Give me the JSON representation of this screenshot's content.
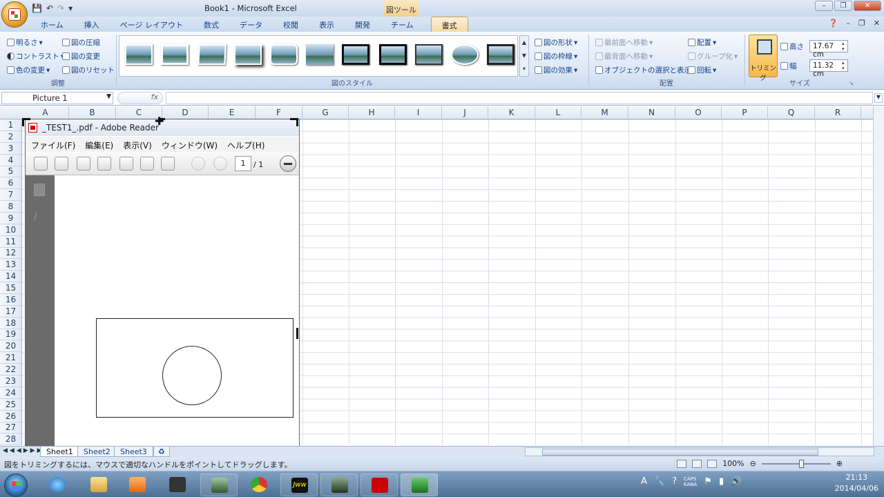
{
  "window": {
    "title": "Book1 - Microsoft Excel",
    "context_tool": "図ツール"
  },
  "tabs": [
    "ホーム",
    "挿入",
    "ページ レイアウト",
    "数式",
    "データ",
    "校閲",
    "表示",
    "開発",
    "チーム",
    "書式"
  ],
  "active_tab": "書式",
  "ribbon": {
    "adjust": {
      "brightness": "明るさ",
      "contrast": "コントラスト",
      "recolor": "色の変更",
      "compress": "図の圧縮",
      "change": "図の変更",
      "reset": "図のリセット",
      "label": "調整"
    },
    "styles": {
      "label": "図のスタイル",
      "shape": "図の形状",
      "border": "図の枠線",
      "effects": "図の効果"
    },
    "arrange": {
      "bring_front": "最前面へ移動",
      "send_back": "最背面へ移動",
      "selection": "オブジェクトの選択と表示",
      "align": "配置",
      "group": "グループ化",
      "rotate": "回転",
      "label": "配置"
    },
    "size": {
      "crop": "トリミング",
      "height_label": "高さ",
      "height": "17.67 cm",
      "width_label": "幅",
      "width": "11.32 cm",
      "label": "サイズ"
    }
  },
  "formula_bar": {
    "name_box": "Picture 1",
    "fx": "fx",
    "value": ""
  },
  "columns": [
    "A",
    "B",
    "C",
    "D",
    "E",
    "F",
    "G",
    "H",
    "I",
    "J",
    "K",
    "L",
    "M",
    "N",
    "O",
    "P",
    "Q",
    "R"
  ],
  "rows": [
    "1",
    "2",
    "3",
    "4",
    "5",
    "6",
    "7",
    "8",
    "9",
    "10",
    "11",
    "12",
    "13",
    "14",
    "15",
    "16",
    "17",
    "18",
    "19",
    "20",
    "21",
    "22",
    "23",
    "24",
    "25",
    "26",
    "27",
    "28"
  ],
  "picture": {
    "title": "_TEST1_.pdf - Adobe Reader",
    "menu": [
      "ファイル(F)",
      "編集(E)",
      "表示(V)",
      "ウィンドウ(W)",
      "ヘルプ(H)"
    ],
    "page_current": "1",
    "page_total": "/ 1"
  },
  "sheets": [
    "Sheet1",
    "Sheet2",
    "Sheet3"
  ],
  "active_sheet": "Sheet1",
  "status": {
    "message": "図をトリミングするには、マウスで適切なハンドルをポイントしてドラッグします。",
    "zoom": "100%"
  },
  "taskbar": {
    "time": "21:13",
    "date": "2014/04/06",
    "caps": "CAPS",
    "kana": "KANA"
  }
}
